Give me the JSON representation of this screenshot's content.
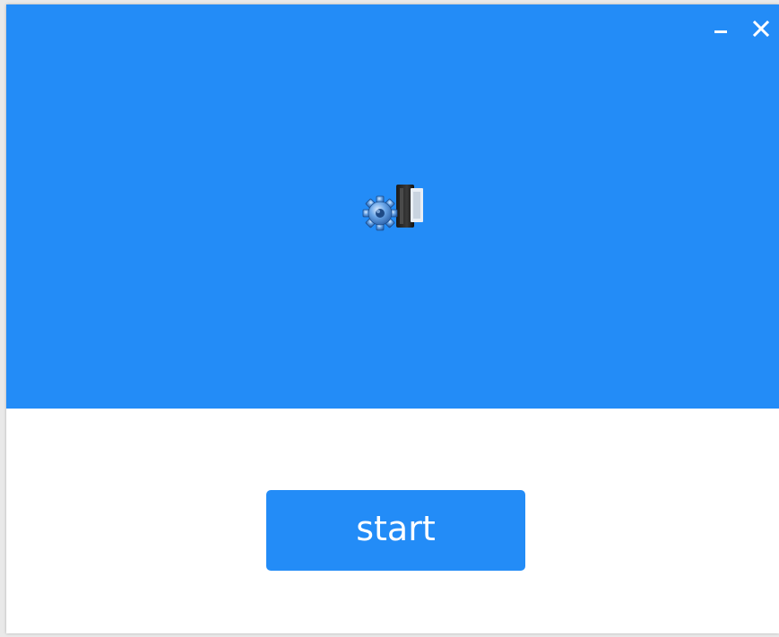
{
  "window": {
    "controls": {
      "minimize_icon": "minimize-icon",
      "close_icon": "close-icon"
    },
    "hero": {
      "background_color": "#238cf7",
      "logo_icon": "gear-connector-icon"
    },
    "actions": {
      "start_label": "start",
      "button_color": "#238cf7"
    }
  }
}
